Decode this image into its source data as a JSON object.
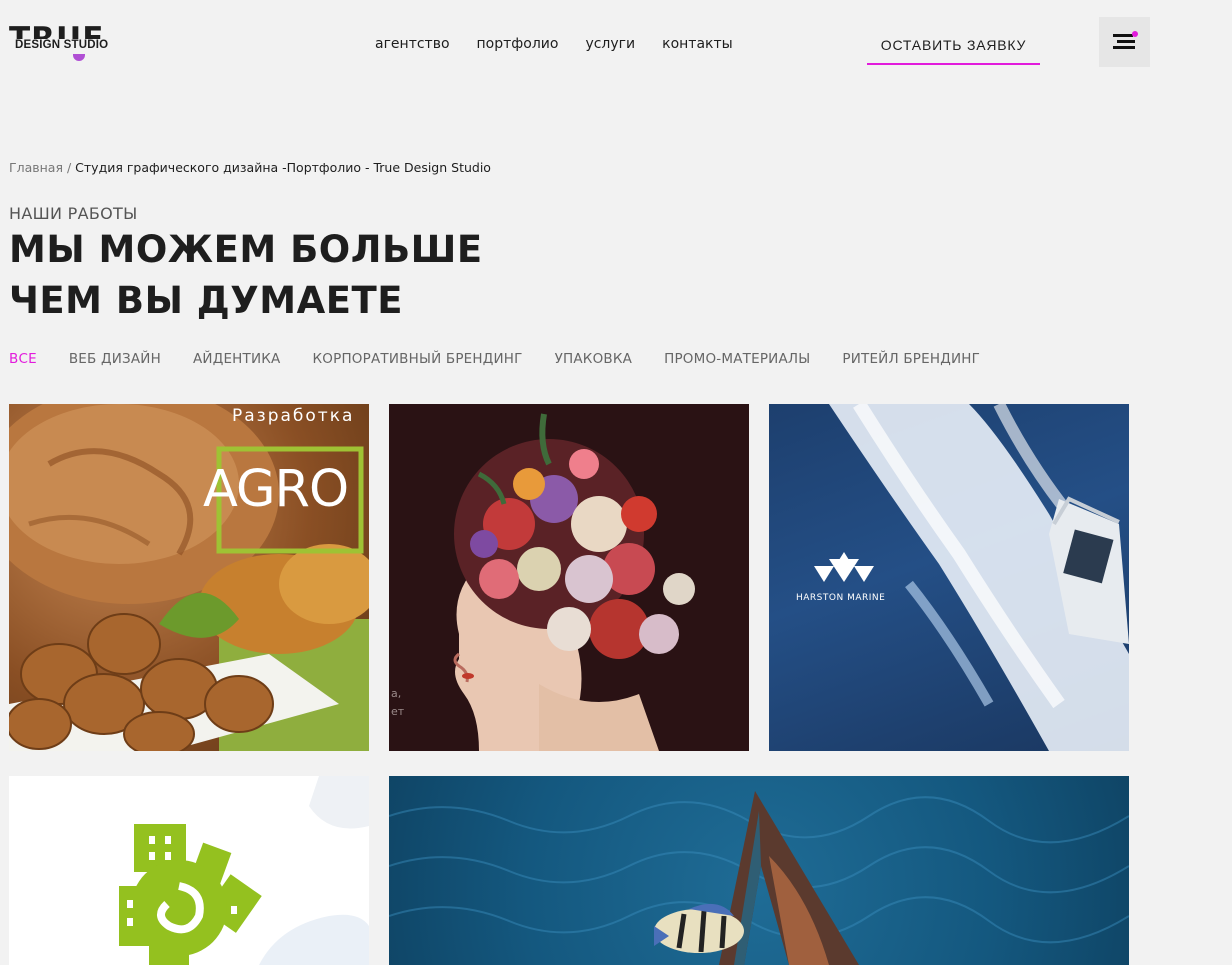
{
  "logo": {
    "main": "TRUE",
    "sub": "DESIGN STUDIO"
  },
  "nav": [
    "агентство",
    "портфолио",
    "услуги",
    "контакты"
  ],
  "cta_label": "ОСТАВИТЬ ЗАЯВКУ",
  "breadcrumb": {
    "home": "Главная",
    "sep": "/",
    "current": "Студия графического дизайна -Портфолио - True Design Studio"
  },
  "eyebrow": "НАШИ РАБОТЫ",
  "headline": [
    "МЫ МОЖЕМ БОЛЬШЕ",
    "ЧЕМ ВЫ ДУМАЕТЕ"
  ],
  "filters": [
    "ВСЕ",
    "ВЕБ ДИЗАЙН",
    "АЙДЕНТИКА",
    "КОРПОРАТИВНЫЙ БРЕНДИНГ",
    "УПАКОВКА",
    "ПРОМО-МАТЕРИАЛЫ",
    "РИТЕЙЛ БРЕНДИНГ"
  ],
  "active_filter": "ВСЕ",
  "tiles": {
    "agro": {
      "caption": "Разработка",
      "brand": "AGRO"
    },
    "flowers": {
      "side_text_1": "а,",
      "side_text_2": "ет"
    },
    "marine": {
      "brand": "HARSTON MARINE"
    }
  },
  "colors": {
    "accent": "#e21bdc",
    "background": "#f2f2f2",
    "text": "#1e1e1e"
  }
}
